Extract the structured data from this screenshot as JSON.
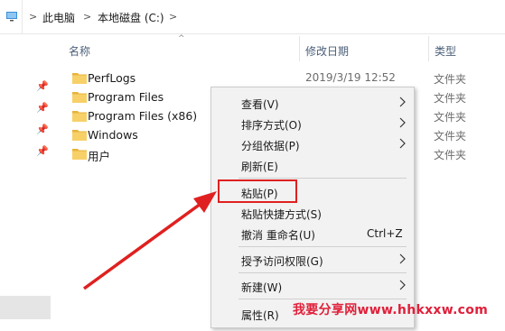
{
  "address_bar": {
    "crumbs": [
      "此电脑",
      "本地磁盘 (C:)"
    ],
    "separator": ">"
  },
  "columns": {
    "name": "名称",
    "date": "修改日期",
    "type": "类型"
  },
  "rows": [
    {
      "name": "PerfLogs",
      "date": "2019/3/19 12:52",
      "type": "文件夹"
    },
    {
      "name": "Program Files",
      "date": "",
      "type": "文件夹"
    },
    {
      "name": "Program Files (x86)",
      "date": "",
      "type": "文件夹"
    },
    {
      "name": "Windows",
      "date": "",
      "type": "文件夹"
    },
    {
      "name": "用户",
      "date": "",
      "type": "文件夹"
    }
  ],
  "context_menu": {
    "view": "查看(V)",
    "sort": "排序方式(O)",
    "group": "分组依据(P)",
    "refresh": "刷新(E)",
    "paste": "粘贴(P)",
    "paste_shortcut": "粘贴快捷方式(S)",
    "undo": "撤消 重命名(U)",
    "undo_shortcut": "Ctrl+Z",
    "access": "授予访问权限(G)",
    "new": "新建(W)",
    "properties": "属性(R)"
  },
  "watermark": {
    "text": "我要分享网www.hhkxxw.com"
  },
  "colors": {
    "highlight_red": "#e02020",
    "folder_yellow": "#f4c84a",
    "header_text": "#4c607a"
  }
}
